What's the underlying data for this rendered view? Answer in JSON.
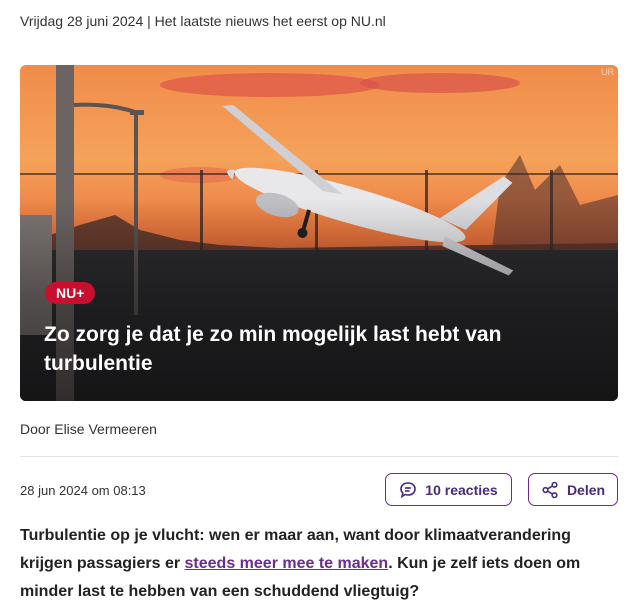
{
  "header": {
    "dateline": "Vrijdag 28 juni 2024 | Het laatste nieuws het eerst op NU.nl"
  },
  "hero": {
    "badge": "NU+",
    "title": "Zo zorg je dat je zo min mogelijk last hebt van turbulentie",
    "watermark": "UR"
  },
  "article": {
    "author": "Door Elise Vermeeren",
    "published": "28 jun 2024 om 08:13",
    "reactions_label": "10 reacties",
    "share_label": "Delen",
    "intro_before": "Turbulentie op je vlucht: wen er maar aan, want door klimaatverandering krijgen passagiers er ",
    "intro_link": "steeds meer mee te maken",
    "intro_after": ". Kun je zelf iets doen om minder last te hebben van een schuddend vliegtuig?"
  },
  "colors": {
    "accent": "#6a2c91",
    "badge": "#c8102e"
  },
  "icons": {
    "reactions": "speech-bubble-icon",
    "share": "share-icon"
  }
}
